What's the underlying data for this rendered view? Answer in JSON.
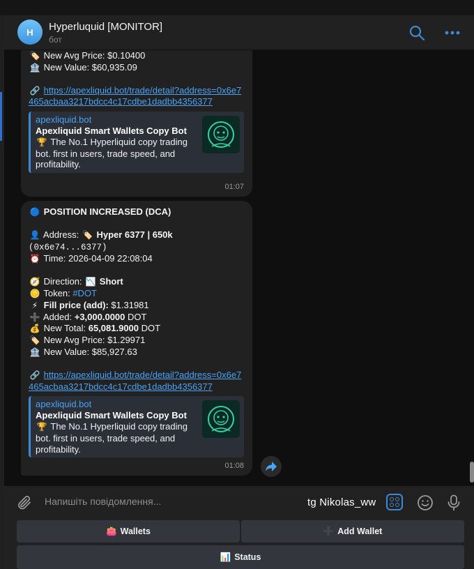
{
  "header": {
    "avatar_letter": "H",
    "title": "Hyperluquid [MONITOR]",
    "subtitle": "бот"
  },
  "messages": [
    {
      "avg_price_emoji": "🏷️",
      "avg_price_label": "New Avg Price: $0.10400",
      "value_emoji": "🏦",
      "value_label": "New Value: $60,935.09",
      "link_emoji": "🔗",
      "link": "https://apexliquid.bot/trade/detail?address=0x6e7465acbaa3217bdcc4c17cdbe1dadbb4356377",
      "preview": {
        "site": "apexliquid.bot",
        "title": "Apexliquid Smart Wallets Copy Bot",
        "desc_emoji": "🏆",
        "description": "The No.1 Hyperliquid copy trading bot. first in users, trade speed, and profitability."
      },
      "time": "01:07"
    },
    {
      "headline_emoji": "🔵",
      "headline": "POSITION INCREASED (DCA)",
      "address_emoji": "👤",
      "address_label": "Address:",
      "address_tag_emoji": "🏷️",
      "address_name": "Hyper 6377 | 650k",
      "address_short": "(0x6e74...6377)",
      "time_emoji": "⏰",
      "time_label": "Time: 2026-04-09 22:08:04",
      "direction_emoji": "🧭",
      "direction_label": "Direction:",
      "direction_icon": "📉",
      "direction_value": "Short",
      "token_emoji": "🪙",
      "token_label": "Token:",
      "token_value": "#DOT",
      "fill_emoji": "⚡",
      "fill_label": "Fill price (add):",
      "fill_value": "$1.31981",
      "added_emoji": "➕",
      "added_label": "Added:",
      "added_value": "+3,000.0000",
      "added_unit": "DOT",
      "total_emoji": "💰",
      "total_label": "New Total:",
      "total_value": "65,081.9000",
      "total_unit": "DOT",
      "avg_price_emoji": "🏷️",
      "avg_price_label": "New Avg Price: $1.29971",
      "value_emoji": "🏦",
      "value_label": "New Value: $85,927.63",
      "link_emoji": "🔗",
      "link": "https://apexliquid.bot/trade/detail?address=0x6e7465acbaa3217bdcc4c17cdbe1dadbb4356377",
      "preview": {
        "site": "apexliquid.bot",
        "title": "Apexliquid Smart Wallets Copy Bot",
        "desc_emoji": "🏆",
        "description": "The No.1 Hyperliquid copy trading bot. first in users, trade speed, and profitability."
      },
      "time": "01:08"
    }
  ],
  "composer": {
    "placeholder": "Напишіть повідомлення...",
    "overlay_text": "tg Nikolas_ww"
  },
  "keyboard": {
    "wallets_emoji": "👛",
    "wallets": "Wallets",
    "add_wallet_emoji": "➕",
    "add_wallet": "Add Wallet",
    "status_emoji": "📊",
    "status": "Status"
  },
  "colors": {
    "accent": "#3e8ad6",
    "link": "#4aa3f5",
    "bubble": "#212121",
    "background": "#0f0f0f"
  }
}
